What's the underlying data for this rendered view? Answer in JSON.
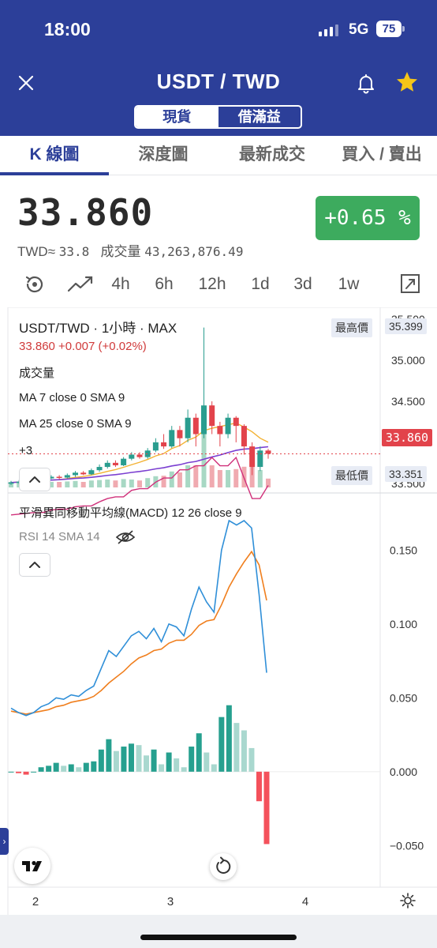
{
  "status_bar": {
    "time": "18:00",
    "network": "5G",
    "battery": "75"
  },
  "header": {
    "title": "USDT / TWD",
    "segments": [
      "現貨",
      "借滿益"
    ]
  },
  "tabs": [
    "K 線圖",
    "深度圖",
    "最新成交",
    "買入 / 賣出"
  ],
  "ticker": {
    "price": "33.860",
    "change": "+0.65 %",
    "twd_label": "TWD≈",
    "twd_value": "33.8",
    "volume_label": "成交量",
    "volume_value": "43,263,876.49"
  },
  "intervals": [
    "4h",
    "6h",
    "12h",
    "1d",
    "3d",
    "1w"
  ],
  "chart": {
    "symbol_line": "USDT/TWD · 1小時 · MAX",
    "ohlc_line": "33.860  +0.007 (+0.02%)",
    "volume_title": "成交量",
    "ma7": "MA 7 close 0 SMA 9",
    "ma25": "MA 25 close 0 SMA 9",
    "more": "+3",
    "high_label": "最高價",
    "high_value": "35.399",
    "low_label": "最低價",
    "low_value": "33.351",
    "current_value": "33.860",
    "price_axis": [
      "35.500",
      "35.000",
      "34.500",
      "34.000",
      "33.500"
    ],
    "macd_title": "平滑異同移動平均線(MACD) 12 26 close 9",
    "rsi_title": "RSI 14 SMA 14",
    "macd_axis": [
      "0.150",
      "0.100",
      "0.050",
      "0.000",
      "−0.050"
    ],
    "time_axis": [
      "2",
      "3",
      "4"
    ]
  },
  "chart_data": {
    "type": "line",
    "title": "平滑異同移動平均線(MACD) 12 26 close 9",
    "xlabel": "",
    "ylabel": "",
    "ylim": [
      -0.06,
      0.17
    ],
    "series": [
      {
        "name": "MACD",
        "color": "#2f8fd8",
        "values": [
          0.043,
          0.04,
          0.038,
          0.04,
          0.044,
          0.046,
          0.05,
          0.049,
          0.052,
          0.051,
          0.055,
          0.058,
          0.07,
          0.082,
          0.078,
          0.085,
          0.092,
          0.095,
          0.09,
          0.097,
          0.088,
          0.1,
          0.098,
          0.092,
          0.11,
          0.125,
          0.115,
          0.108,
          0.15,
          0.17,
          0.167,
          0.17,
          0.165,
          0.12,
          0.067
        ]
      },
      {
        "name": "Signal",
        "color": "#f07f1e",
        "values": [
          0.041,
          0.04,
          0.039,
          0.04,
          0.041,
          0.042,
          0.044,
          0.045,
          0.047,
          0.048,
          0.049,
          0.051,
          0.055,
          0.06,
          0.064,
          0.068,
          0.073,
          0.077,
          0.079,
          0.082,
          0.083,
          0.087,
          0.089,
          0.089,
          0.093,
          0.099,
          0.102,
          0.103,
          0.113,
          0.125,
          0.134,
          0.142,
          0.149,
          0.14,
          0.116
        ]
      },
      {
        "name": "Histogram",
        "color": "#2a9d8f",
        "values": [
          0.0,
          -0.001,
          -0.002,
          0.0,
          0.003,
          0.004,
          0.006,
          0.004,
          0.005,
          0.003,
          0.006,
          0.007,
          0.015,
          0.022,
          0.014,
          0.017,
          0.019,
          0.018,
          0.011,
          0.015,
          0.005,
          0.013,
          0.009,
          0.003,
          0.017,
          0.026,
          0.013,
          0.005,
          0.037,
          0.045,
          0.033,
          0.028,
          0.016,
          -0.02,
          -0.049
        ]
      }
    ],
    "price_candles": [
      {
        "o": 33.5,
        "c": 33.51,
        "h": 33.53,
        "l": 33.48
      },
      {
        "o": 33.51,
        "c": 33.52,
        "h": 33.54,
        "l": 33.49
      },
      {
        "o": 33.52,
        "c": 33.54,
        "h": 33.56,
        "l": 33.5
      },
      {
        "o": 33.54,
        "c": 33.53,
        "h": 33.56,
        "l": 33.51
      },
      {
        "o": 33.53,
        "c": 33.56,
        "h": 33.58,
        "l": 33.52
      },
      {
        "o": 33.56,
        "c": 33.58,
        "h": 33.6,
        "l": 33.55
      },
      {
        "o": 33.58,
        "c": 33.57,
        "h": 33.6,
        "l": 33.55
      },
      {
        "o": 33.57,
        "c": 33.6,
        "h": 33.62,
        "l": 33.56
      },
      {
        "o": 33.6,
        "c": 33.63,
        "h": 33.65,
        "l": 33.58
      },
      {
        "o": 33.63,
        "c": 33.61,
        "h": 33.65,
        "l": 33.6
      },
      {
        "o": 33.61,
        "c": 33.66,
        "h": 33.68,
        "l": 33.6
      },
      {
        "o": 33.66,
        "c": 33.7,
        "h": 33.73,
        "l": 33.64
      },
      {
        "o": 33.7,
        "c": 33.75,
        "h": 33.78,
        "l": 33.68
      },
      {
        "o": 33.75,
        "c": 33.72,
        "h": 33.78,
        "l": 33.7
      },
      {
        "o": 33.72,
        "c": 33.8,
        "h": 33.82,
        "l": 33.71
      },
      {
        "o": 33.8,
        "c": 33.85,
        "h": 33.88,
        "l": 33.78
      },
      {
        "o": 33.85,
        "c": 33.82,
        "h": 33.88,
        "l": 33.8
      },
      {
        "o": 33.82,
        "c": 33.9,
        "h": 33.93,
        "l": 33.8
      },
      {
        "o": 33.9,
        "c": 34.0,
        "h": 34.05,
        "l": 33.88
      },
      {
        "o": 34.0,
        "c": 33.95,
        "h": 34.1,
        "l": 33.92
      },
      {
        "o": 33.95,
        "c": 34.15,
        "h": 34.2,
        "l": 33.93
      },
      {
        "o": 34.15,
        "c": 34.05,
        "h": 34.2,
        "l": 33.95
      },
      {
        "o": 34.05,
        "c": 34.3,
        "h": 34.4,
        "l": 34.0
      },
      {
        "o": 34.3,
        "c": 34.1,
        "h": 34.35,
        "l": 33.95
      },
      {
        "o": 34.1,
        "c": 34.45,
        "h": 35.4,
        "l": 34.05
      },
      {
        "o": 34.45,
        "c": 34.2,
        "h": 34.5,
        "l": 34.1
      },
      {
        "o": 34.2,
        "c": 34.1,
        "h": 34.25,
        "l": 33.95
      },
      {
        "o": 34.1,
        "c": 34.3,
        "h": 34.35,
        "l": 34.05
      },
      {
        "o": 34.3,
        "c": 34.2,
        "h": 34.32,
        "l": 34.0
      },
      {
        "o": 34.2,
        "c": 33.95,
        "h": 34.22,
        "l": 33.85
      },
      {
        "o": 33.95,
        "c": 33.7,
        "h": 34.0,
        "l": 33.6
      },
      {
        "o": 33.7,
        "c": 33.9,
        "h": 33.95,
        "l": 33.65
      },
      {
        "o": 33.9,
        "c": 33.86,
        "h": 33.92,
        "l": 33.8
      }
    ],
    "price_ylim": [
      33.45,
      35.55
    ]
  },
  "colors": {
    "brand": "#2c3f99",
    "up": "#2a9d8f",
    "down": "#e2434b",
    "badge": "#3dab5e"
  }
}
